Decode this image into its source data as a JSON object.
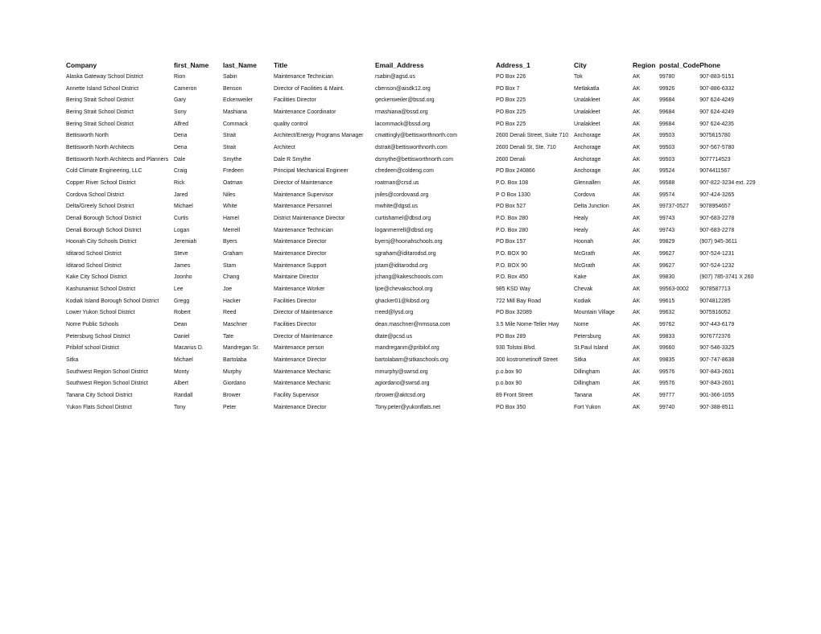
{
  "columns": [
    "Company",
    "first_Name",
    "last_Name",
    "Title",
    "Email_Address",
    "Address_1",
    "City",
    "Region",
    "postal_Code",
    "Phone"
  ],
  "rows": [
    [
      "Alaska Gateway School District",
      "Rion",
      "Sabin",
      "Maintenance Technician",
      "rsabin@agsd.us",
      "PO Box 226",
      "Tok",
      "AK",
      "99780",
      "907-883-5151"
    ],
    [
      "Annette Island School District",
      "Cameron",
      "Benson",
      "Director of Facilities & Maint.",
      "cbenson@aisdk12.org",
      "PO Box 7",
      "Metlakatla",
      "AK",
      "99926",
      "907-886-6332"
    ],
    [
      "Bering Strait School District",
      "Gary",
      "Eckenweiler",
      "Facilities Director",
      "geckenweiler@bssd.org",
      "PO Box 225",
      "Unalakleet",
      "AK",
      "99684",
      "907 624-4249"
    ],
    [
      "Bering Strait School District",
      "Sony",
      "Mashiana",
      "Maintenance Coordinator",
      "rmashiana@bssd.org",
      "PO Box 225",
      "Unalakleet",
      "AK",
      "99684",
      "907 624-4249"
    ],
    [
      "Bering Strait School District",
      "Alfred",
      "Commack",
      "quality control",
      "lacommack@bssd.org",
      "PO Box 225",
      "Unalakleet",
      "AK",
      "99684",
      "907 624-4235"
    ],
    [
      "Bettisworth North",
      "Dena",
      "Strait",
      "Architect/Energy Programs Manager",
      "cmattingly@bettisworthnorth.com",
      "2600 Denali Street, Suite 710",
      "Anchorage",
      "AK",
      "99503",
      "9075615780"
    ],
    [
      "Bettisworth North Architects",
      "Dena",
      "Strait",
      "Architect",
      "dstrait@bettisworthnorth.com",
      "2600 Denali St, Ste. 710",
      "Anchorage",
      "AK",
      "99503",
      "907-567-5780"
    ],
    [
      "Bettisworth North Architects and Planners",
      "Dale",
      "Smythe",
      "Dale R Smythe",
      "dsmythe@bettisworthnorth.com",
      "2600 Denali",
      "Anchorage",
      "AK",
      "99503",
      "9077714523"
    ],
    [
      "Cold Climate Engineering, LLC",
      "Craig",
      "Fredeen",
      "Principal Mechanical Engineer",
      "cfredeen@coldeng.com",
      "PO Box 240866",
      "Anchorage",
      "AK",
      "99524",
      "9074411567"
    ],
    [
      "Copper River School District",
      "Rick",
      "Oatman",
      "Director of Maintenance",
      "roatman@crsd.us",
      "P.O. Box 108",
      "Glennallen",
      "AK",
      "99588",
      "907-822-3234 ext. 229"
    ],
    [
      "Cordova School District",
      "Jared",
      "Niles",
      "Maintenance Supervisor",
      "jniles@cordovasd.org",
      "P O Box 1330",
      "Cordova",
      "AK",
      "99574",
      "907-424-3265"
    ],
    [
      "Delta/Greely School District",
      "Michael",
      "White",
      "Maintenance Personnel",
      "mwhite@dgsd.us",
      "PO Box 527",
      "Delta Junction",
      "AK",
      "99737-0527",
      "9078954657"
    ],
    [
      "Denali Borough School District",
      "Curtis",
      "Hamel",
      "District Maintenance Director",
      "curtishamel@dbsd.org",
      "P.O. Box 280",
      "Healy",
      "AK",
      "99743",
      "907-683-2278"
    ],
    [
      "Denali Borough School District",
      "Logan",
      "Merrell",
      "Maintenance Technician",
      "loganmerrell@dbsd.org",
      "P.O. Box 280",
      "Healy",
      "AK",
      "99743",
      "907-683-2278"
    ],
    [
      "Hoonah City Schools District",
      "Jeremiah",
      "Byers",
      "Maintenance Director",
      "byersj@hoonahschools.org",
      "PO Box 157",
      "Hoonah",
      "AK",
      "99829",
      "(907) 945-3611"
    ],
    [
      "Iditarod School District",
      "Steve",
      "Graham",
      "Maintenance Director",
      "sgraham@iditarodsd.org",
      "P.O. BOX 90",
      "McGrath",
      "AK",
      "99627",
      "907-524-1231"
    ],
    [
      "Iditarod School District",
      "James",
      "Stam",
      "Maintenance Support",
      "jstam@iditarodsd.org",
      "P.O. BOX 90",
      "McGrath",
      "AK",
      "99627",
      "907-524-1232"
    ],
    [
      "Kake City School District",
      "Joonho",
      "Chang",
      "Maintaine Director",
      "jchang@kakeschoools.com",
      "P.O. Box 450",
      "Kake",
      "AK",
      "99830",
      "(907) 785-3741 X 260"
    ],
    [
      "Kashunamiut School District",
      "Lee",
      "Joe",
      "Maintenance Worker",
      "ljoe@chevakschool.org",
      "985 KSD Way",
      "Chevak",
      "AK",
      "99563-0002",
      "9078587713"
    ],
    [
      "Kodiak Island Borough School District",
      "Gregg",
      "Hacker",
      "Facilities Director",
      "ghacker01@kibsd.org",
      "722 Mill Bay Road",
      "Kodiak",
      "AK",
      "99615",
      "9074812285"
    ],
    [
      "Lower Yukon School District",
      "Robert",
      "Reed",
      "Director of Maintenance",
      "rreed@lysd.org",
      "PO Box 32089",
      "Mountain Village",
      "AK",
      "99632",
      "9075916052"
    ],
    [
      "Nome Public Schools",
      "Dean",
      "Maschner",
      "Facilities Director",
      "dean.maschner@nmsusa.com",
      "3.5 Mile Nome-Teller Hwy",
      "Nome",
      "AK",
      "99762",
      "907-443-6179"
    ],
    [
      "Petersburg School District",
      "Daniel",
      "Tate",
      "Director of Maintenance",
      "dtate@pcsd.us",
      "PO Box 289",
      "Petersburg",
      "AK",
      "99833",
      "9076772376"
    ],
    [
      "Pribilof school District",
      "Macarius D.",
      "Mandregan Sr.",
      "Maintenance person",
      "mandreganm@pribilof.org",
      "930 Tolstoi Blvd.",
      "St.Paul  Island",
      "AK",
      "99660",
      "907-546-3325"
    ],
    [
      "Sitka",
      "Michael",
      "Bartolaba",
      "Maintenance Director",
      "bartolabam@sitkaschools.org",
      "300 kostrometinoff Street",
      "Sitka",
      "AK",
      "99835",
      "907-747-8638"
    ],
    [
      "Southwest Region School District",
      "Monty",
      "Murphy",
      "Maintenance Mechanic",
      "mmurphy@swrsd.org",
      "p.o.box 90",
      "Dillingham",
      "AK",
      "99576",
      "907-843-2601"
    ],
    [
      "Southwest Region School District",
      "Albert",
      "Giordano",
      "Maintenance Mechanic",
      "agiordano@swrsd.org",
      "p.o.box 90",
      "Dillingham",
      "AK",
      "99576",
      "907-843-2601"
    ],
    [
      "Tanana City School District",
      "Randall",
      "Brower",
      "Facility Supervisor",
      "rbrower@aktcsd.org",
      "89 Front Street",
      "Tanana",
      "AK",
      "99777",
      "901-366-1055"
    ],
    [
      "Yukon Flats School District",
      "Tony",
      "Peter",
      "Maintenance Director",
      "Tony.peter@yukonflats.net",
      "PO Box 350",
      "Fort Yukon",
      "AK",
      "99740",
      "907-388-8511"
    ]
  ]
}
